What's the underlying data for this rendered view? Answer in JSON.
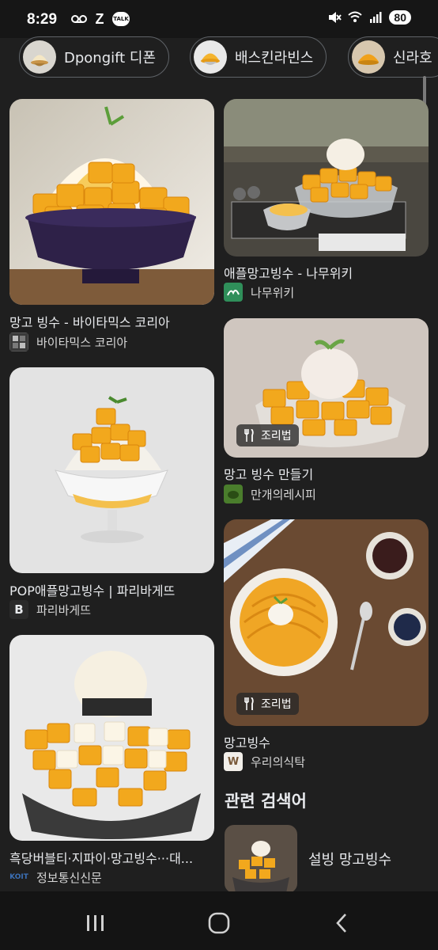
{
  "status_bar": {
    "time": "8:29",
    "talk_label": "TALK",
    "battery": "80"
  },
  "chips": [
    {
      "label": "Dpongift 디폰"
    },
    {
      "label": "배스킨라빈스"
    },
    {
      "label": "신라호"
    }
  ],
  "results": [
    {
      "title": "망고 빙수 - 바이타믹스 코리아",
      "source": "바이타믹스 코리아"
    },
    {
      "title": "애플망고빙수 - 나무위키",
      "source": "나무위키"
    },
    {
      "title": "POP애플망고빙수 | 파리바게뜨",
      "source": "파리바게뜨"
    },
    {
      "title": "망고 빙수 만들기",
      "source": "만개의레시피",
      "badge": "조리법"
    },
    {
      "title": "흑당버블티·지파이·망고빙수···대...",
      "source": "정보통신신문"
    },
    {
      "title": "망고빙수",
      "source": "우리의식탁",
      "badge": "조리법"
    }
  ],
  "related": {
    "heading": "관련 검색어",
    "items": [
      {
        "label": "설빙 망고빙수"
      }
    ]
  },
  "colors": {
    "background": "#1f1f1f",
    "mango": "#f2a81d",
    "text": "#e8eaed"
  }
}
